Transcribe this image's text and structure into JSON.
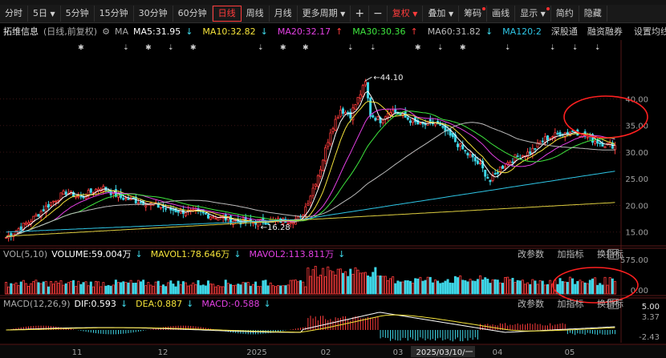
{
  "toolbar": {
    "items": [
      "分时",
      "5日",
      "5分钟",
      "15分钟",
      "30分钟",
      "60分钟",
      "日线",
      "周线",
      "月线",
      "更多周期",
      "复权",
      "叠加",
      "筹码",
      "画线",
      "显示",
      "简约",
      "隐藏"
    ],
    "active": "日线"
  },
  "stock": {
    "name": "拓维信息",
    "mode": "(日线,前复权)"
  },
  "ma_legend": [
    {
      "label": "MA5:31.95",
      "arrow": "↓",
      "color": "#ffffff"
    },
    {
      "label": "MA10:32.82",
      "arrow": "↓",
      "color": "#f5e33a"
    },
    {
      "label": "MA20:32.17",
      "arrow": "↑",
      "color": "#e440e4"
    },
    {
      "label": "MA30:30.36",
      "arrow": "↑",
      "color": "#3ee63e"
    },
    {
      "label": "MA60:31.82",
      "arrow": "↓",
      "color": "#bbbbbb"
    },
    {
      "label": "MA120:2",
      "arrow": "",
      "color": "#2ec6e6"
    }
  ],
  "ma_prefix": "MA",
  "links": [
    "深股通",
    "融资融券"
  ],
  "settings_label": "设置均线",
  "price_axis": {
    "ticks": [
      "40.00",
      "35.00",
      "30.00",
      "25.00",
      "20.00",
      "15.00"
    ],
    "values": [
      40,
      35,
      30,
      25,
      20,
      15
    ]
  },
  "annotations": {
    "high": "44.10",
    "low": "16.28"
  },
  "volume": {
    "head": "VOL(5,10)",
    "items": [
      {
        "label": "VOLUME:59.004万",
        "arrow": "↓",
        "color": "#ffffff"
      },
      {
        "label": "MAVOL1:78.646万",
        "arrow": "↓",
        "color": "#f5e33a"
      },
      {
        "label": "MAVOL2:113.811万",
        "arrow": "↓",
        "color": "#e440e4"
      }
    ],
    "ticks": [
      "575.00",
      "0.00"
    ]
  },
  "macd": {
    "head": "MACD(12,26,9)",
    "items": [
      {
        "label": "DIF:0.593",
        "arrow": "↓",
        "color": "#ffffff"
      },
      {
        "label": "DEA:0.887",
        "arrow": "↓",
        "color": "#f5e33a"
      },
      {
        "label": "MACD:-0.588",
        "arrow": "↓",
        "color": "#e440e4"
      }
    ],
    "ticks": [
      "5.00",
      "3.37",
      "-2.43"
    ]
  },
  "pane_buttons": [
    "改参数",
    "加指标",
    "换指标"
  ],
  "x_axis": {
    "labels": [
      "11",
      "12",
      "2025",
      "02",
      "03",
      "2025/03/10/一",
      "04",
      "05"
    ]
  },
  "colors": {
    "up": "#ff3c3c",
    "down": "#3fd7e8",
    "ann": "#ff2020"
  }
}
